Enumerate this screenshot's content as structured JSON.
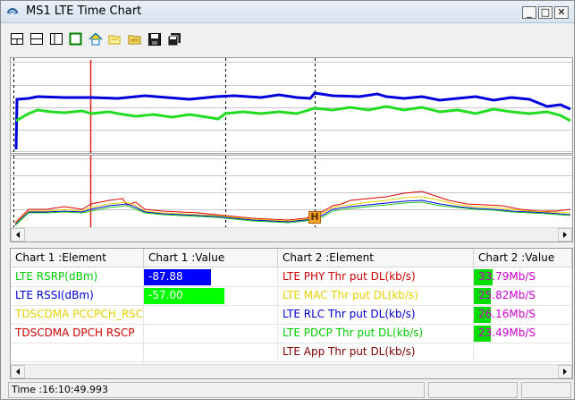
{
  "window": {
    "title": "MS1 LTE Time Chart"
  },
  "window_buttons": {
    "minimize": "_",
    "maximize": "□",
    "close": "✕"
  },
  "toolbar": {
    "buttons": [
      "layout-1-icon",
      "layout-2-icon",
      "layout-3-icon",
      "color-box-icon",
      "home-icon",
      "folder-open-icon",
      "folder-icon",
      "save-icon",
      "save-all-icon"
    ]
  },
  "marker": {
    "label": "H"
  },
  "table": {
    "headers": [
      "Chart 1 :Element",
      "Chart 1 :Value",
      "Chart 2 :Element",
      "Chart 2 :Value"
    ],
    "rows": [
      {
        "el1": "LTE RSRP(dBm)",
        "el1_color": "#00cc00",
        "val1": "-87.88",
        "val1_bar_color": "#0000ff",
        "val1_bar_fraction": 0.5,
        "el2": "LTE PHY Thr put DL(kb/s)",
        "el2_color": "#cc0000",
        "val2": "33.79Mb/S",
        "val2_bar_fraction": 0.19
      },
      {
        "el1": "LTE RSSI(dBm)",
        "el1_color": "#0000cc",
        "val1": "-57.00",
        "val1_bar_color": "#00ff00",
        "val1_bar_fraction": 0.6,
        "el2": "LTE MAC Thr put DL(kb/s)",
        "el2_color": "#e6d200",
        "val2": "25.82Mb/S",
        "val2_bar_fraction": 0.17
      },
      {
        "el1": "TDSCDMA PCCPCH_RSCP",
        "el1_color": "#e6d200",
        "val1": "",
        "val1_bar_color": "",
        "val1_bar_fraction": 0,
        "el2": "LTE RLC Thr put DL(kb/s)",
        "el2_color": "#0000cc",
        "val2": "26.16Mb/S",
        "val2_bar_fraction": 0.17
      },
      {
        "el1": "TDSCDMA DPCH RSCP",
        "el1_color": "#cc0000",
        "val1": "",
        "val1_bar_color": "",
        "val1_bar_fraction": 0,
        "el2": "LTE PDCP Thr put DL(kb/s)",
        "el2_color": "#00cc00",
        "val2": "23.49Mb/S",
        "val2_bar_fraction": 0.17
      },
      {
        "el1": "",
        "el1_color": "#000000",
        "val1": "",
        "val1_bar_color": "",
        "val1_bar_fraction": 0,
        "el2": "LTE App Thr put DL(kb/s)",
        "el2_color": "#800000",
        "val2": "",
        "val2_bar_fraction": 0
      }
    ]
  },
  "status": {
    "time": "Time :16:10:49.993"
  },
  "colors": {
    "chart2_value_bar": "#00dd00",
    "chart2_value_text": "#cc00cc"
  }
}
